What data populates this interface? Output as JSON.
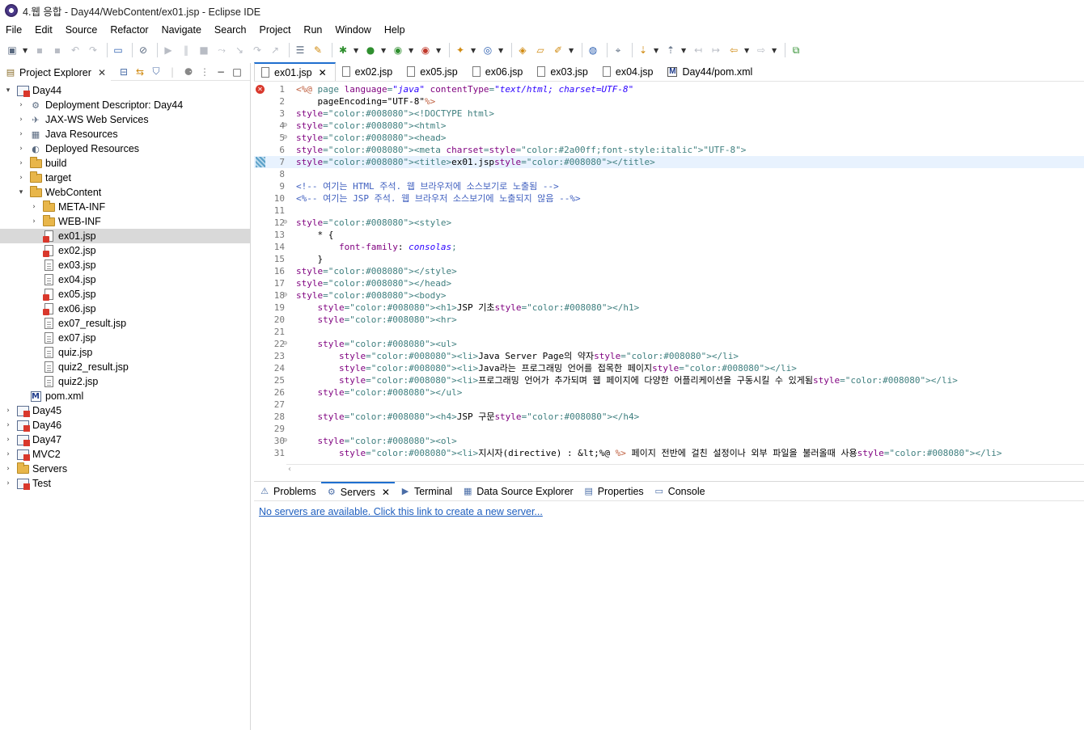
{
  "window": {
    "title": "4.웹 응합 - Day44/WebContent/ex01.jsp - Eclipse IDE"
  },
  "menu": [
    "File",
    "Edit",
    "Source",
    "Refactor",
    "Navigate",
    "Search",
    "Project",
    "Run",
    "Window",
    "Help"
  ],
  "explorer": {
    "tab_label": "Project Explorer",
    "tree": [
      {
        "label": "Day44",
        "twisty": "▾",
        "icon": "project",
        "indent": 0
      },
      {
        "label": "Deployment Descriptor: Day44",
        "twisty": "›",
        "icon": "descriptor",
        "indent": 1
      },
      {
        "label": "JAX-WS Web Services",
        "twisty": "›",
        "icon": "webservice",
        "indent": 1
      },
      {
        "label": "Java Resources",
        "twisty": "›",
        "icon": "java-resources",
        "indent": 1
      },
      {
        "label": "Deployed Resources",
        "twisty": "›",
        "icon": "deployed",
        "indent": 1
      },
      {
        "label": "build",
        "twisty": "›",
        "icon": "folder",
        "indent": 1
      },
      {
        "label": "target",
        "twisty": "›",
        "icon": "folder",
        "indent": 1
      },
      {
        "label": "WebContent",
        "twisty": "▾",
        "icon": "folder-error",
        "indent": 1
      },
      {
        "label": "META-INF",
        "twisty": "›",
        "icon": "folder",
        "indent": 2
      },
      {
        "label": "WEB-INF",
        "twisty": "›",
        "icon": "folder",
        "indent": 2
      },
      {
        "label": "ex01.jsp",
        "twisty": "",
        "icon": "jsp-error",
        "indent": 2,
        "selected": true
      },
      {
        "label": "ex02.jsp",
        "twisty": "",
        "icon": "jsp-error",
        "indent": 2
      },
      {
        "label": "ex03.jsp",
        "twisty": "",
        "icon": "file",
        "indent": 2
      },
      {
        "label": "ex04.jsp",
        "twisty": "",
        "icon": "file",
        "indent": 2
      },
      {
        "label": "ex05.jsp",
        "twisty": "",
        "icon": "jsp-error",
        "indent": 2
      },
      {
        "label": "ex06.jsp",
        "twisty": "",
        "icon": "jsp-error",
        "indent": 2
      },
      {
        "label": "ex07_result.jsp",
        "twisty": "",
        "icon": "file",
        "indent": 2
      },
      {
        "label": "ex07.jsp",
        "twisty": "",
        "icon": "file",
        "indent": 2
      },
      {
        "label": "quiz.jsp",
        "twisty": "",
        "icon": "file",
        "indent": 2
      },
      {
        "label": "quiz2_result.jsp",
        "twisty": "",
        "icon": "file",
        "indent": 2
      },
      {
        "label": "quiz2.jsp",
        "twisty": "",
        "icon": "file",
        "indent": 2
      },
      {
        "label": "pom.xml",
        "twisty": "",
        "icon": "maven",
        "indent": 1
      },
      {
        "label": "Day45",
        "twisty": "›",
        "icon": "project",
        "indent": 0
      },
      {
        "label": "Day46",
        "twisty": "›",
        "icon": "project",
        "indent": 0
      },
      {
        "label": "Day47",
        "twisty": "›",
        "icon": "project",
        "indent": 0
      },
      {
        "label": "MVC2",
        "twisty": "›",
        "icon": "project",
        "indent": 0
      },
      {
        "label": "Servers",
        "twisty": "›",
        "icon": "folder",
        "indent": 0
      },
      {
        "label": "Test",
        "twisty": "›",
        "icon": "project-plain",
        "indent": 0
      }
    ]
  },
  "editor": {
    "tabs": [
      {
        "label": "ex01.jsp",
        "active": true,
        "icon": "file"
      },
      {
        "label": "ex02.jsp",
        "icon": "file"
      },
      {
        "label": "ex05.jsp",
        "icon": "file"
      },
      {
        "label": "ex06.jsp",
        "icon": "file"
      },
      {
        "label": "ex03.jsp",
        "icon": "file"
      },
      {
        "label": "ex04.jsp",
        "icon": "file"
      },
      {
        "label": "Day44/pom.xml",
        "icon": "maven"
      }
    ],
    "lines": [
      {
        "n": "1",
        "text": "<%@ page language=\"java\" contentType=\"text/html; charset=UTF-8\"",
        "error": true
      },
      {
        "n": "2",
        "text": "    pageEncoding=\"UTF-8\"%>"
      },
      {
        "n": "3",
        "text": "<!DOCTYPE html>"
      },
      {
        "n": "4",
        "text": "<html>",
        "fold": true
      },
      {
        "n": "5",
        "text": "<head>",
        "fold": true
      },
      {
        "n": "6",
        "text": "<meta charset=\"UTF-8\">"
      },
      {
        "n": "7",
        "text": "<title>ex01.jsp</title>",
        "current": true
      },
      {
        "n": "8",
        "text": ""
      },
      {
        "n": "9",
        "text": "<!-- 여기는 HTML 주석. 웹 브라우저에 소스보기로 노출됨 -->"
      },
      {
        "n": "10",
        "text": "<%-- 여기는 JSP 주석. 웹 브라우저 소스보기에 노출되지 않음 --%>"
      },
      {
        "n": "11",
        "text": ""
      },
      {
        "n": "12",
        "text": "<style>",
        "fold": true
      },
      {
        "n": "13",
        "text": "    * {"
      },
      {
        "n": "14",
        "text": "        font-family: consolas;"
      },
      {
        "n": "15",
        "text": "    }"
      },
      {
        "n": "16",
        "text": "</style>"
      },
      {
        "n": "17",
        "text": "</head>"
      },
      {
        "n": "18",
        "text": "<body>",
        "fold": true
      },
      {
        "n": "19",
        "text": "    <h1>JSP 기초</h1>"
      },
      {
        "n": "20",
        "text": "    <hr>"
      },
      {
        "n": "21",
        "text": ""
      },
      {
        "n": "22",
        "text": "    <ul>",
        "fold": true
      },
      {
        "n": "23",
        "text": "        <li>Java Server Page의 약자</li>"
      },
      {
        "n": "24",
        "text": "        <li>Java라는 프로그래밍 언어를 접목한 페이지</li>"
      },
      {
        "n": "25",
        "text": "        <li>프로그래밍 언어가 추가되며 웹 페이지에 다양한 어플리케이션을 구동시킬 수 있게됨</li>"
      },
      {
        "n": "26",
        "text": "    </ul>"
      },
      {
        "n": "27",
        "text": ""
      },
      {
        "n": "28",
        "text": "    <h4>JSP 구문</h4>"
      },
      {
        "n": "29",
        "text": ""
      },
      {
        "n": "30",
        "text": "    <ol>",
        "fold": true
      },
      {
        "n": "31",
        "text": "        <li>지시자(directive) : &lt;%@ %> 페이지 전반에 걸친 설정이나 외부 파일을 불러올때 사용</li>"
      }
    ],
    "scroll_indicator": "‹"
  },
  "bottom_panel": {
    "tabs": [
      {
        "label": "Problems",
        "icon": "problems-icon"
      },
      {
        "label": "Servers",
        "icon": "servers-icon",
        "active": true
      },
      {
        "label": "Terminal",
        "icon": "terminal-icon"
      },
      {
        "label": "Data Source Explorer",
        "icon": "datasource-icon"
      },
      {
        "label": "Properties",
        "icon": "properties-icon"
      },
      {
        "label": "Console",
        "icon": "console-icon"
      }
    ],
    "servers_message": "No servers are available. Click this link to create a new server..."
  }
}
